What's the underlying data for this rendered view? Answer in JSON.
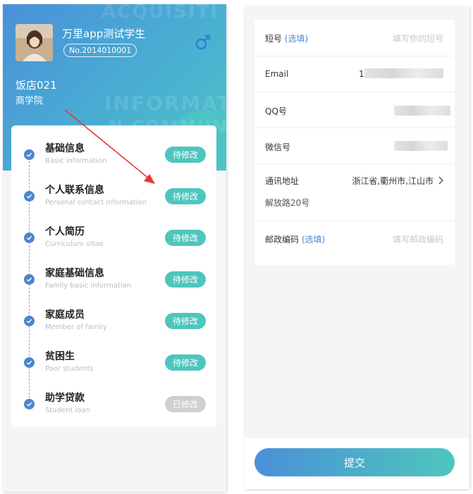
{
  "left": {
    "watermarks": [
      "ACQUISITI",
      "INFORMAT",
      "N COMMUNIC"
    ],
    "student_name": "万里app测试学生",
    "student_no": "No.2014010001",
    "shop_name": "饭店021",
    "college": "商学院",
    "icons": {
      "gender": "male-icon",
      "check": "check-icon"
    },
    "sections": [
      {
        "title": "基础信息",
        "subtitle": "Basic information",
        "status": "待修改",
        "done": false
      },
      {
        "title": "个人联系信息",
        "subtitle": "Personal contact information",
        "status": "待修改",
        "done": false
      },
      {
        "title": "个人简历",
        "subtitle": "Curriculum vitae",
        "status": "待修改",
        "done": false
      },
      {
        "title": "家庭基础信息",
        "subtitle": "Family basic information",
        "status": "待修改",
        "done": false
      },
      {
        "title": "家庭成员",
        "subtitle": "Member of family",
        "status": "待修改",
        "done": false
      },
      {
        "title": "贫困生",
        "subtitle": "Poor students",
        "status": "待修改",
        "done": false
      },
      {
        "title": "助学贷款",
        "subtitle": "Student loan",
        "status": "已修改",
        "done": true
      }
    ]
  },
  "right": {
    "fields": {
      "short_no": {
        "label": "短号",
        "optional": "(选填)",
        "placeholder": "填写你的短号"
      },
      "email": {
        "label": "Email",
        "value_prefix": "1"
      },
      "qq": {
        "label": "QQ号"
      },
      "wechat": {
        "label": "微信号"
      },
      "address": {
        "label": "通讯地址",
        "region": "浙江省,衢州市,江山市",
        "detail": "解放路20号"
      },
      "postcode": {
        "label": "邮政编码",
        "optional": "(选填)",
        "placeholder": "填写邮政编码"
      }
    },
    "submit_label": "提交"
  },
  "colors": {
    "gradient_start": "#4a90d9",
    "gradient_end": "#4dc3c6",
    "badge_pending": "#4ec6bd",
    "badge_done": "#cfcfcf",
    "arrow": "#e53935",
    "optional_text": "#4a86cf"
  }
}
